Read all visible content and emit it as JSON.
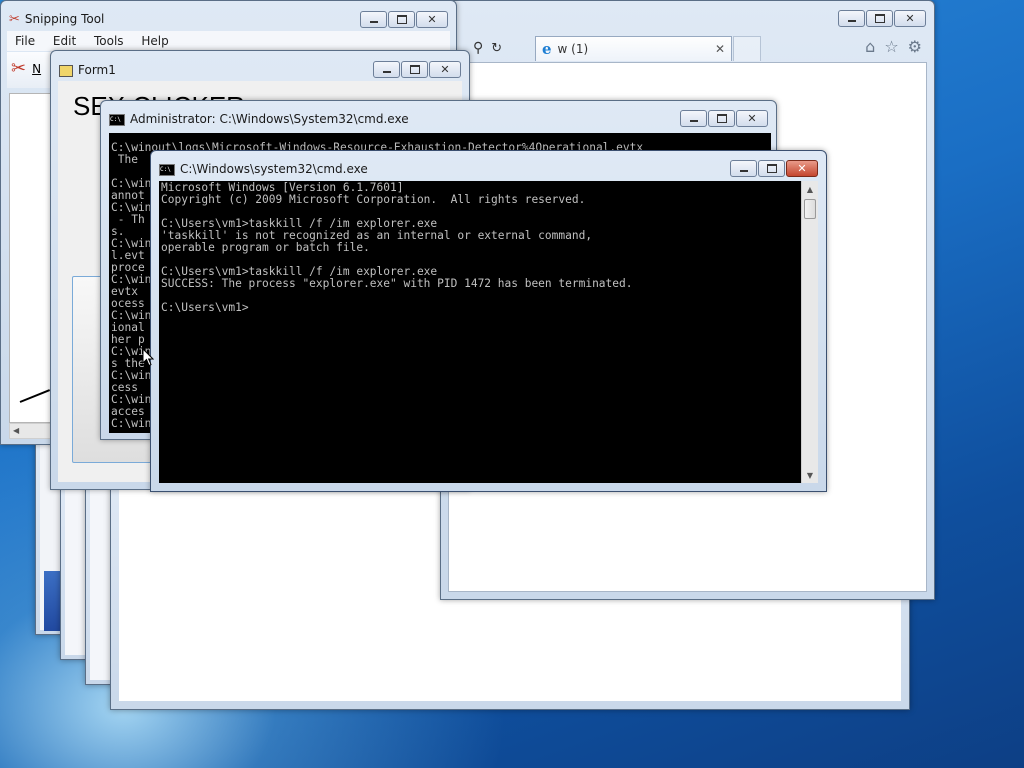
{
  "snipping_tool": {
    "title": "Snipping Tool",
    "menu": [
      "File",
      "Edit",
      "Tools",
      "Help"
    ],
    "new_button_partial": "N"
  },
  "browser": {
    "tab_label": "w (1)",
    "home_icon": "home-icon",
    "favorites_icon": "star-icon",
    "tools_icon": "gear-icon"
  },
  "form1": {
    "title": "Form1",
    "heading_partial": "SEX CLICKER"
  },
  "admin_cmd": {
    "title": "Administrator: C:\\Windows\\System32\\cmd.exe",
    "lines": [
      "C:\\winout\\logs\\Microsoft-Windows-Resource-Exhaustion-Detector%4Operational.evtx",
      " The",
      "",
      "C:\\win",
      "annot",
      "C:\\win",
      " - Th",
      "s.",
      "C:\\win",
      "l.evt",
      "proce",
      "C:\\win",
      "evtx",
      "ocess",
      "C:\\win",
      "ional",
      "her p",
      "C:\\win",
      "s the",
      "C:\\win",
      "cess",
      "C:\\win",
      "acces",
      "C:\\win"
    ]
  },
  "cmd": {
    "title": "C:\\Windows\\system32\\cmd.exe",
    "lines": [
      "Microsoft Windows [Version 6.1.7601]",
      "Copyright (c) 2009 Microsoft Corporation.  All rights reserved.",
      "",
      "C:\\Users\\vm1>taskkill /f /im explorer.exe",
      "'taskkill' is not recognized as an internal or external command,",
      "operable program or batch file.",
      "",
      "C:\\Users\\vm1>taskkill /f /im explorer.exe",
      "SUCCESS: The process \"explorer.exe\" with PID 1472 has been terminated.",
      "",
      "C:\\Users\\vm1>"
    ]
  }
}
